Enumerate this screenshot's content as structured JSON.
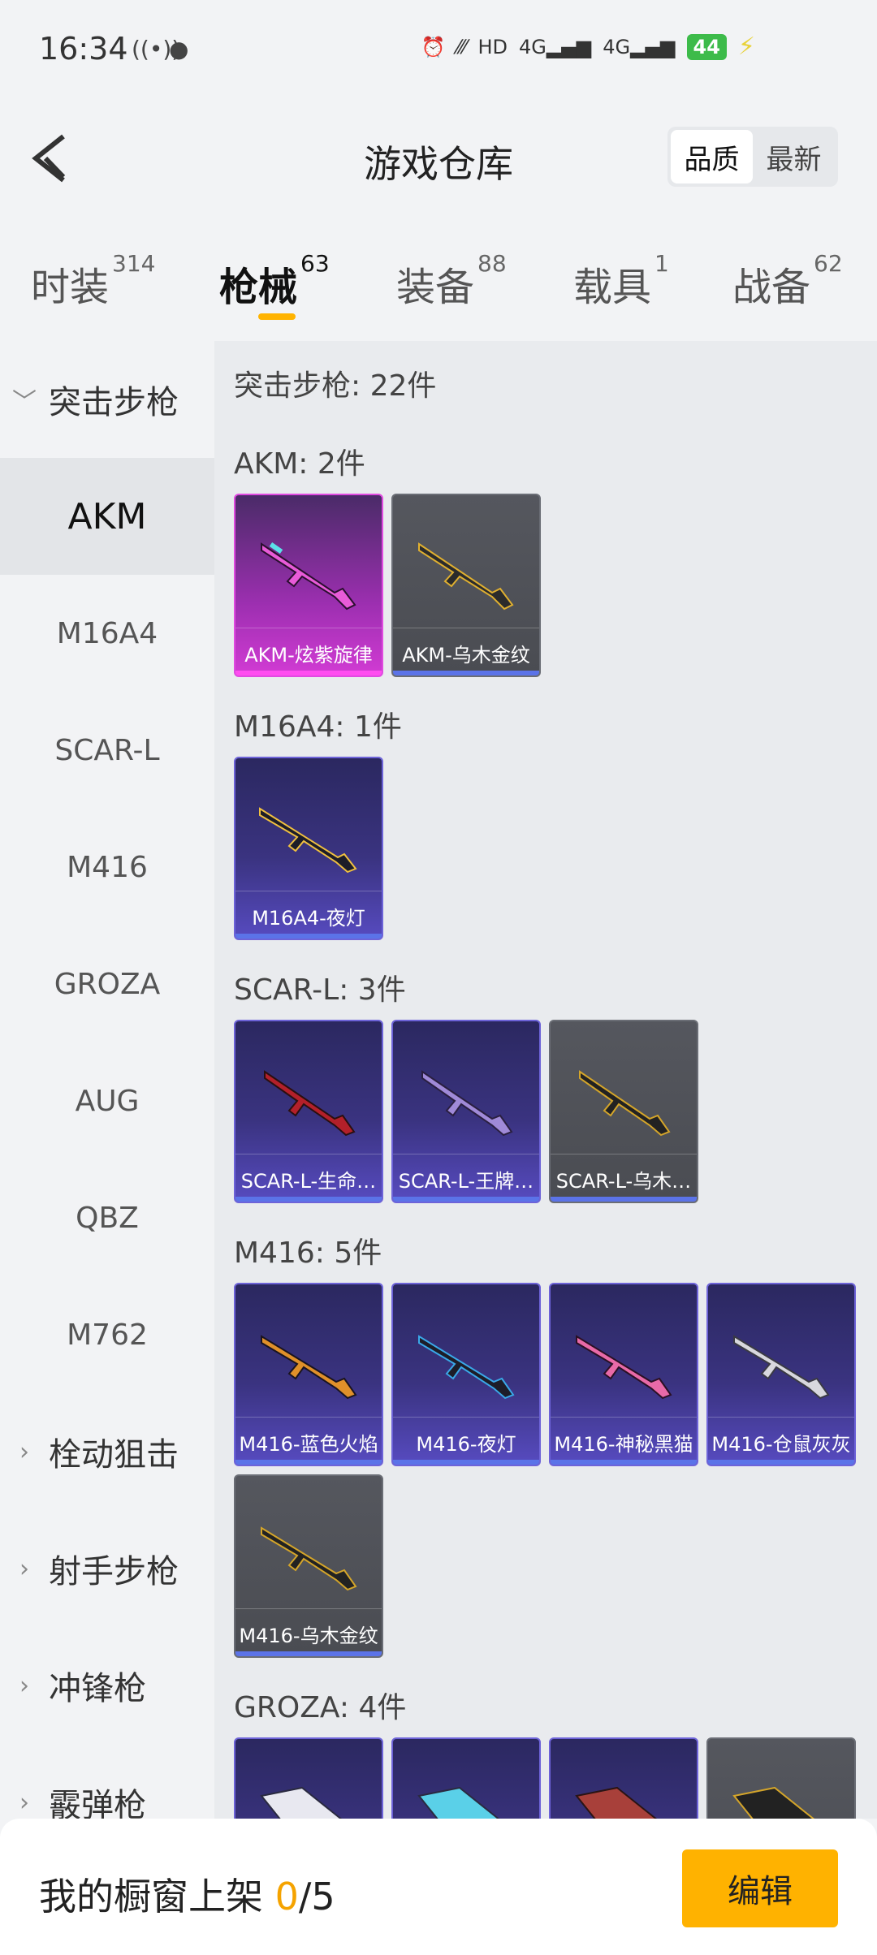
{
  "status": {
    "time": "16:34",
    "battery": "44"
  },
  "header": {
    "title": "游戏仓库",
    "sort": [
      "品质",
      "最新"
    ]
  },
  "tabs": [
    {
      "label": "时装",
      "count": "314"
    },
    {
      "label": "枪械",
      "count": "63"
    },
    {
      "label": "装备",
      "count": "88"
    },
    {
      "label": "载具",
      "count": "1"
    },
    {
      "label": "战备",
      "count": "62"
    }
  ],
  "sidebar": {
    "group_assault": "突击步枪",
    "items": [
      "AKM",
      "M16A4",
      "SCAR-L",
      "M416",
      "GROZA",
      "AUG",
      "QBZ",
      "M762"
    ],
    "group_bolt": "栓动狙击",
    "group_marksman": "射手步枪",
    "group_smg": "冲锋枪",
    "group_shotgun": "霰弹枪"
  },
  "content": {
    "summary": "突击步枪: 22件",
    "groups": [
      {
        "title": "AKM: 2件",
        "cards": [
          "AKM-炫紫旋律",
          "AKM-乌木金纹"
        ]
      },
      {
        "title": "M16A4: 1件",
        "cards": [
          "M16A4-夜灯"
        ]
      },
      {
        "title": "SCAR-L: 3件",
        "cards": [
          "SCAR-L-生命…",
          "SCAR-L-王牌…",
          "SCAR-L-乌木…"
        ]
      },
      {
        "title": "M416: 5件",
        "cards": [
          "M416-蓝色火焰",
          "M416-夜灯",
          "M416-神秘黑猫",
          "M416-仓鼠灰灰",
          "M416-乌木金纹"
        ]
      },
      {
        "title": "GROZA: 4件",
        "cards": []
      }
    ]
  },
  "bottom": {
    "text": "我的橱窗上架 ",
    "count": "0",
    "total": "/5",
    "edit": "编辑"
  }
}
